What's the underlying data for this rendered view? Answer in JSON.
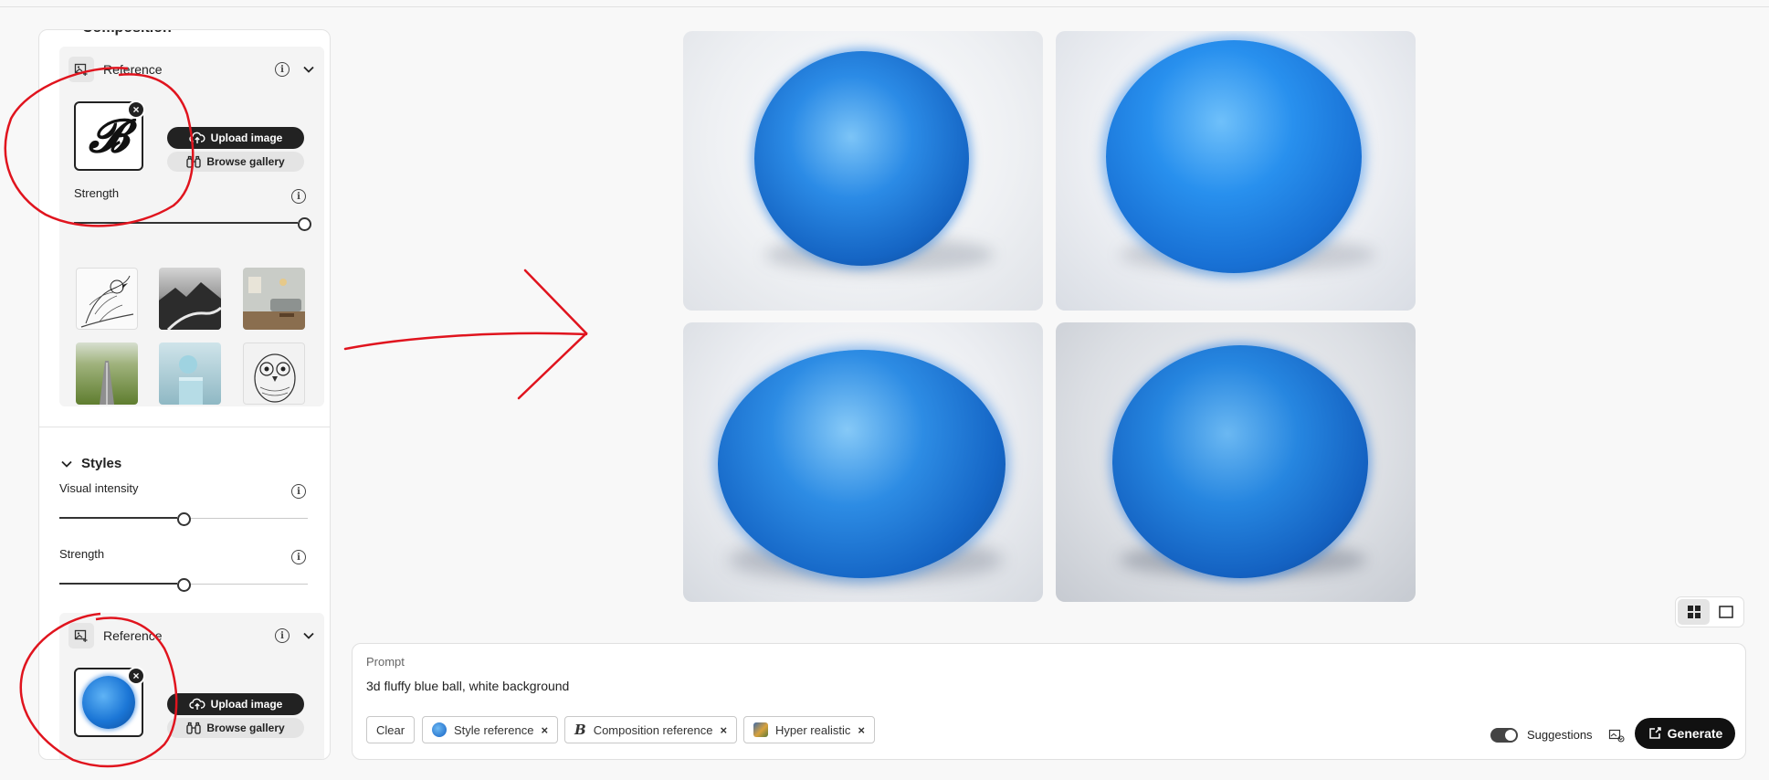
{
  "panel": {
    "section_title": "Composition",
    "composition_ref": {
      "label": "Reference",
      "upload_label": "Upload image",
      "browse_label": "Browse gallery",
      "strength_label": "Strength",
      "strength_value": 1.0
    },
    "styles": {
      "title": "Styles",
      "visual_intensity_label": "Visual intensity",
      "visual_intensity_value": 0.5,
      "strength_label": "Strength",
      "strength_value": 0.5
    },
    "style_ref": {
      "label": "Reference",
      "upload_label": "Upload image",
      "browse_label": "Browse gallery"
    }
  },
  "prompt": {
    "title": "Prompt",
    "text": "3d fluffy blue ball, white background",
    "clear_label": "Clear",
    "chips": [
      {
        "label": "Style reference"
      },
      {
        "label": "Composition reference"
      },
      {
        "label": "Hyper realistic"
      }
    ],
    "suggestions_label": "Suggestions",
    "generate_label": "Generate"
  },
  "colors": {
    "accent": "#111111",
    "ball_blue": "#1b7ee0",
    "annotation_red": "#e0141e"
  }
}
